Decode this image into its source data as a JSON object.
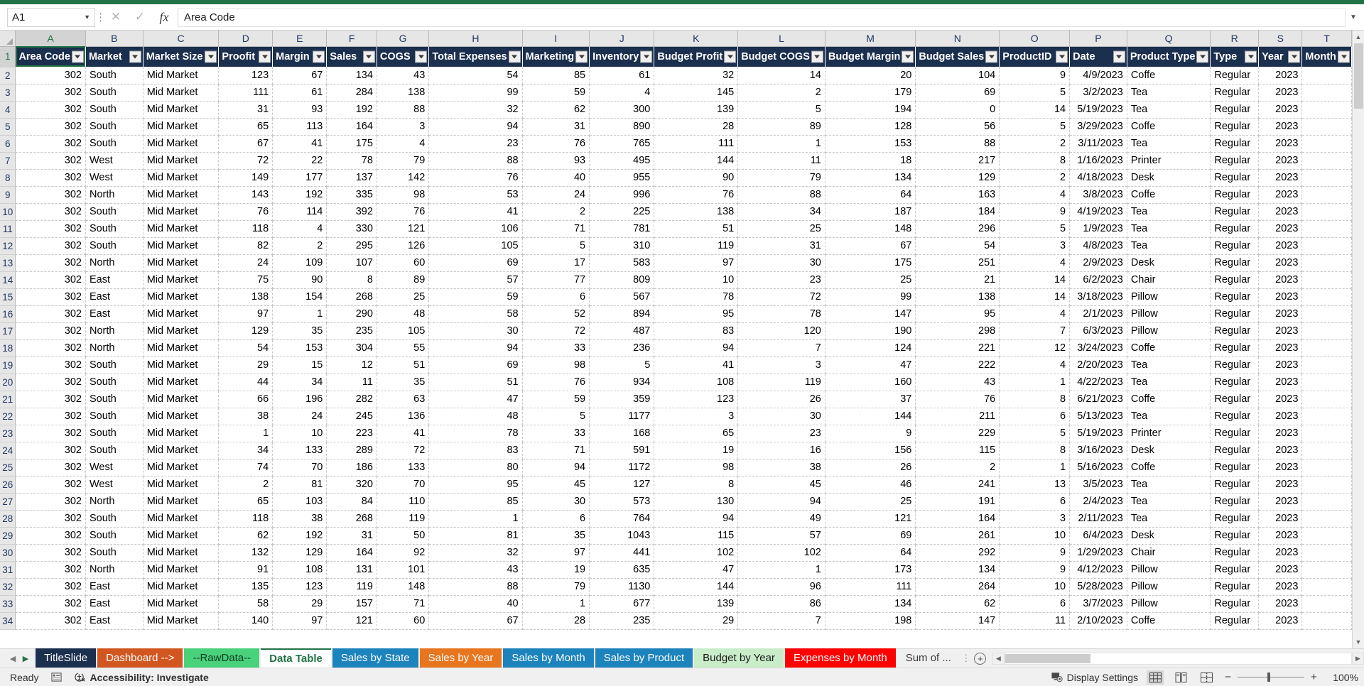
{
  "app": {
    "accent_green": "#217346",
    "header_navy": "#1b2f4e"
  },
  "formula_bar": {
    "name_box_value": "A1",
    "cancel_icon": "close-icon",
    "confirm_icon": "check-icon",
    "fx_label": "fx",
    "formula_value": "Area Code",
    "dropdown_icon": "chevron-down-icon",
    "expand_icon": "chevron-down-icon"
  },
  "grid": {
    "column_letters": [
      "A",
      "B",
      "C",
      "D",
      "E",
      "F",
      "G",
      "H",
      "I",
      "J",
      "K",
      "L",
      "M",
      "N",
      "O",
      "P",
      "Q",
      "R",
      "S",
      "T"
    ],
    "selected_column": "A",
    "selected_row": "1",
    "headers": [
      "Area Code",
      "Market",
      "Market Size",
      "Proofit",
      "Margin",
      "Sales",
      "COGS",
      "Total Expenses",
      "Marketing",
      "Inventory",
      "Budget Profit",
      "Budget COGS",
      "Budget Margin",
      "Budget Sales",
      "ProductID",
      "Date",
      "Product Type",
      "Type",
      "Year",
      "Month"
    ],
    "row_numbers": [
      "1",
      "2",
      "3",
      "4",
      "5",
      "6",
      "7",
      "8",
      "9",
      "10",
      "11",
      "12",
      "13",
      "14",
      "15",
      "16",
      "17",
      "18",
      "19",
      "20",
      "21",
      "22",
      "23",
      "24",
      "25",
      "26",
      "27",
      "28",
      "29",
      "30",
      "31",
      "32",
      "33",
      "34"
    ],
    "rows": [
      [
        "302",
        "South",
        "Mid Market",
        "123",
        "67",
        "134",
        "43",
        "54",
        "85",
        "61",
        "32",
        "14",
        "20",
        "104",
        "9",
        "4/9/2023",
        "Coffe",
        "Regular",
        "2023",
        ""
      ],
      [
        "302",
        "South",
        "Mid Market",
        "111",
        "61",
        "284",
        "138",
        "99",
        "59",
        "4",
        "145",
        "2",
        "179",
        "69",
        "5",
        "3/2/2023",
        "Tea",
        "Regular",
        "2023",
        ""
      ],
      [
        "302",
        "South",
        "Mid Market",
        "31",
        "93",
        "192",
        "88",
        "32",
        "62",
        "300",
        "139",
        "5",
        "194",
        "0",
        "14",
        "5/19/2023",
        "Tea",
        "Regular",
        "2023",
        ""
      ],
      [
        "302",
        "South",
        "Mid Market",
        "65",
        "113",
        "164",
        "3",
        "94",
        "31",
        "890",
        "28",
        "89",
        "128",
        "56",
        "5",
        "3/29/2023",
        "Coffe",
        "Regular",
        "2023",
        ""
      ],
      [
        "302",
        "South",
        "Mid Market",
        "67",
        "41",
        "175",
        "4",
        "23",
        "76",
        "765",
        "111",
        "1",
        "153",
        "88",
        "2",
        "3/11/2023",
        "Tea",
        "Regular",
        "2023",
        ""
      ],
      [
        "302",
        "West",
        "Mid Market",
        "72",
        "22",
        "78",
        "79",
        "88",
        "93",
        "495",
        "144",
        "11",
        "18",
        "217",
        "8",
        "1/16/2023",
        "Printer",
        "Regular",
        "2023",
        ""
      ],
      [
        "302",
        "West",
        "Mid Market",
        "149",
        "177",
        "137",
        "142",
        "76",
        "40",
        "955",
        "90",
        "79",
        "134",
        "129",
        "2",
        "4/18/2023",
        "Desk",
        "Regular",
        "2023",
        ""
      ],
      [
        "302",
        "North",
        "Mid Market",
        "143",
        "192",
        "335",
        "98",
        "53",
        "24",
        "996",
        "76",
        "88",
        "64",
        "163",
        "4",
        "3/8/2023",
        "Coffe",
        "Regular",
        "2023",
        ""
      ],
      [
        "302",
        "South",
        "Mid Market",
        "76",
        "114",
        "392",
        "76",
        "41",
        "2",
        "225",
        "138",
        "34",
        "187",
        "184",
        "9",
        "4/19/2023",
        "Tea",
        "Regular",
        "2023",
        ""
      ],
      [
        "302",
        "South",
        "Mid Market",
        "118",
        "4",
        "330",
        "121",
        "106",
        "71",
        "781",
        "51",
        "25",
        "148",
        "296",
        "5",
        "1/9/2023",
        "Tea",
        "Regular",
        "2023",
        ""
      ],
      [
        "302",
        "South",
        "Mid Market",
        "82",
        "2",
        "295",
        "126",
        "105",
        "5",
        "310",
        "119",
        "31",
        "67",
        "54",
        "3",
        "4/8/2023",
        "Tea",
        "Regular",
        "2023",
        ""
      ],
      [
        "302",
        "North",
        "Mid Market",
        "24",
        "109",
        "107",
        "60",
        "69",
        "17",
        "583",
        "97",
        "30",
        "175",
        "251",
        "4",
        "2/9/2023",
        "Desk",
        "Regular",
        "2023",
        ""
      ],
      [
        "302",
        "East",
        "Mid Market",
        "75",
        "90",
        "8",
        "89",
        "57",
        "77",
        "809",
        "10",
        "23",
        "25",
        "21",
        "14",
        "6/2/2023",
        "Chair",
        "Regular",
        "2023",
        ""
      ],
      [
        "302",
        "East",
        "Mid Market",
        "138",
        "154",
        "268",
        "25",
        "59",
        "6",
        "567",
        "78",
        "72",
        "99",
        "138",
        "14",
        "3/18/2023",
        "Pillow",
        "Regular",
        "2023",
        ""
      ],
      [
        "302",
        "East",
        "Mid Market",
        "97",
        "1",
        "290",
        "48",
        "58",
        "52",
        "894",
        "95",
        "78",
        "147",
        "95",
        "4",
        "2/1/2023",
        "Pillow",
        "Regular",
        "2023",
        ""
      ],
      [
        "302",
        "North",
        "Mid Market",
        "129",
        "35",
        "235",
        "105",
        "30",
        "72",
        "487",
        "83",
        "120",
        "190",
        "298",
        "7",
        "6/3/2023",
        "Pillow",
        "Regular",
        "2023",
        ""
      ],
      [
        "302",
        "North",
        "Mid Market",
        "54",
        "153",
        "304",
        "55",
        "94",
        "33",
        "236",
        "94",
        "7",
        "124",
        "221",
        "12",
        "3/24/2023",
        "Coffe",
        "Regular",
        "2023",
        ""
      ],
      [
        "302",
        "South",
        "Mid Market",
        "29",
        "15",
        "12",
        "51",
        "69",
        "98",
        "5",
        "41",
        "3",
        "47",
        "222",
        "4",
        "2/20/2023",
        "Tea",
        "Regular",
        "2023",
        ""
      ],
      [
        "302",
        "South",
        "Mid Market",
        "44",
        "34",
        "11",
        "35",
        "51",
        "76",
        "934",
        "108",
        "119",
        "160",
        "43",
        "1",
        "4/22/2023",
        "Tea",
        "Regular",
        "2023",
        ""
      ],
      [
        "302",
        "South",
        "Mid Market",
        "66",
        "196",
        "282",
        "63",
        "47",
        "59",
        "359",
        "123",
        "26",
        "37",
        "76",
        "8",
        "6/21/2023",
        "Coffe",
        "Regular",
        "2023",
        ""
      ],
      [
        "302",
        "South",
        "Mid Market",
        "38",
        "24",
        "245",
        "136",
        "48",
        "5",
        "1177",
        "3",
        "30",
        "144",
        "211",
        "6",
        "5/13/2023",
        "Tea",
        "Regular",
        "2023",
        ""
      ],
      [
        "302",
        "South",
        "Mid Market",
        "1",
        "10",
        "223",
        "41",
        "78",
        "33",
        "168",
        "65",
        "23",
        "9",
        "229",
        "5",
        "5/19/2023",
        "Printer",
        "Regular",
        "2023",
        ""
      ],
      [
        "302",
        "South",
        "Mid Market",
        "34",
        "133",
        "289",
        "72",
        "83",
        "71",
        "591",
        "19",
        "16",
        "156",
        "115",
        "8",
        "3/16/2023",
        "Desk",
        "Regular",
        "2023",
        ""
      ],
      [
        "302",
        "West",
        "Mid Market",
        "74",
        "70",
        "186",
        "133",
        "80",
        "94",
        "1172",
        "98",
        "38",
        "26",
        "2",
        "1",
        "5/16/2023",
        "Coffe",
        "Regular",
        "2023",
        ""
      ],
      [
        "302",
        "West",
        "Mid Market",
        "2",
        "81",
        "320",
        "70",
        "95",
        "45",
        "127",
        "8",
        "45",
        "46",
        "241",
        "13",
        "3/5/2023",
        "Tea",
        "Regular",
        "2023",
        ""
      ],
      [
        "302",
        "North",
        "Mid Market",
        "65",
        "103",
        "84",
        "110",
        "85",
        "30",
        "573",
        "130",
        "94",
        "25",
        "191",
        "6",
        "2/4/2023",
        "Tea",
        "Regular",
        "2023",
        ""
      ],
      [
        "302",
        "South",
        "Mid Market",
        "118",
        "38",
        "268",
        "119",
        "1",
        "6",
        "764",
        "94",
        "49",
        "121",
        "164",
        "3",
        "2/11/2023",
        "Tea",
        "Regular",
        "2023",
        ""
      ],
      [
        "302",
        "South",
        "Mid Market",
        "62",
        "192",
        "31",
        "50",
        "81",
        "35",
        "1043",
        "115",
        "57",
        "69",
        "261",
        "10",
        "6/4/2023",
        "Desk",
        "Regular",
        "2023",
        ""
      ],
      [
        "302",
        "South",
        "Mid Market",
        "132",
        "129",
        "164",
        "92",
        "32",
        "97",
        "441",
        "102",
        "102",
        "64",
        "292",
        "9",
        "1/29/2023",
        "Chair",
        "Regular",
        "2023",
        ""
      ],
      [
        "302",
        "North",
        "Mid Market",
        "91",
        "108",
        "131",
        "101",
        "43",
        "19",
        "635",
        "47",
        "1",
        "173",
        "134",
        "9",
        "4/12/2023",
        "Pillow",
        "Regular",
        "2023",
        ""
      ],
      [
        "302",
        "East",
        "Mid Market",
        "135",
        "123",
        "119",
        "148",
        "88",
        "79",
        "1130",
        "144",
        "96",
        "111",
        "264",
        "10",
        "5/28/2023",
        "Pillow",
        "Regular",
        "2023",
        ""
      ],
      [
        "302",
        "East",
        "Mid Market",
        "58",
        "29",
        "157",
        "71",
        "40",
        "1",
        "677",
        "139",
        "86",
        "134",
        "62",
        "6",
        "3/7/2023",
        "Pillow",
        "Regular",
        "2023",
        ""
      ],
      [
        "302",
        "East",
        "Mid Market",
        "140",
        "97",
        "121",
        "60",
        "67",
        "28",
        "235",
        "29",
        "7",
        "198",
        "147",
        "11",
        "2/10/2023",
        "Coffe",
        "Regular",
        "2023",
        ""
      ]
    ],
    "vscroll": {
      "up_icon": "chevron-up-icon",
      "down_icon": "chevron-down-icon"
    }
  },
  "sheet_tabs": {
    "nav_first_icon": "first-sheet-icon",
    "nav_prev_icon": "prev-sheet-icon",
    "add_sheet_icon": "plus-icon",
    "overflow_icon": "ellipsis-icon",
    "items": [
      {
        "label": "TitleSlide",
        "color": "#1b2f4e",
        "text_color": "#ffffff",
        "active": false
      },
      {
        "label": "Dashboard -->",
        "color": "#d2561f",
        "text_color": "#ffffff",
        "active": false
      },
      {
        "label": "--RawData--",
        "color": "#4ad17c",
        "text_color": "#0c3d20",
        "active": false
      },
      {
        "label": "Data Table",
        "color": "#ffffff",
        "text_color": "#217346",
        "active": true
      },
      {
        "label": "Sales by State",
        "color": "#1c83bd",
        "text_color": "#ffffff",
        "active": false
      },
      {
        "label": "Sales by Year",
        "color": "#e8761e",
        "text_color": "#ffffff",
        "active": false
      },
      {
        "label": "Sales by Month",
        "color": "#1c83bd",
        "text_color": "#ffffff",
        "active": false
      },
      {
        "label": "Sales by Product",
        "color": "#1c83bd",
        "text_color": "#ffffff",
        "active": false
      },
      {
        "label": "Budget by Year",
        "color": "#c9ecc9",
        "text_color": "#1a1a1a",
        "active": false
      },
      {
        "label": "Expenses by Month",
        "color": "#fe0000",
        "text_color": "#ffffff",
        "active": false
      },
      {
        "label": "Sum of ...",
        "color": "transparent",
        "text_color": "#3a3a3a",
        "active": false
      }
    ]
  },
  "status_bar": {
    "mode": "Ready",
    "macro_icon": "record-macro-icon",
    "accessibility_icon": "accessibility-icon",
    "accessibility_label": "Accessibility: Investigate",
    "display_settings_icon": "display-settings-icon",
    "display_settings_label": "Display Settings",
    "view_normal_icon": "normal-view-icon",
    "view_pagelayout_icon": "page-layout-view-icon",
    "view_pagebreak_icon": "page-break-view-icon",
    "zoom_out_label": "−",
    "zoom_in_label": "+",
    "zoom_level": "100%"
  }
}
